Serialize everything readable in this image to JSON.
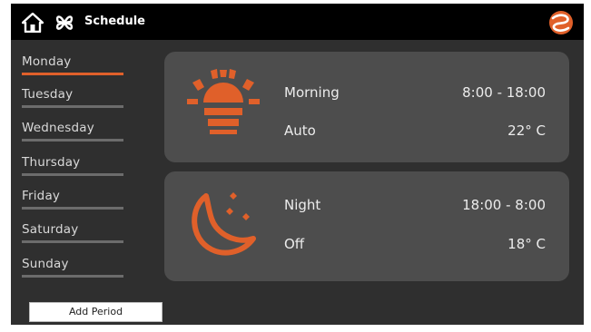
{
  "header": {
    "title": "Schedule",
    "home_icon": "home-icon",
    "mode_icon": "propeller-icon",
    "logo_icon": "brand-logo-icon",
    "accent_color": "#e0602a"
  },
  "sidebar": {
    "days": [
      {
        "label": "Monday",
        "active": true
      },
      {
        "label": "Tuesday",
        "active": false
      },
      {
        "label": "Wednesday",
        "active": false
      },
      {
        "label": "Thursday",
        "active": false
      },
      {
        "label": "Friday",
        "active": false
      },
      {
        "label": "Saturday",
        "active": false
      },
      {
        "label": "Sunday",
        "active": false
      }
    ],
    "add_button_label": "Add Period"
  },
  "periods": [
    {
      "icon": "sunrise-icon",
      "name": "Morning",
      "time": "8:00 - 18:00",
      "mode": "Auto",
      "temperature": "22° C"
    },
    {
      "icon": "moon-stars-icon",
      "name": "Night",
      "time": "18:00 - 8:00",
      "mode": "Off",
      "temperature": "18° C"
    }
  ]
}
